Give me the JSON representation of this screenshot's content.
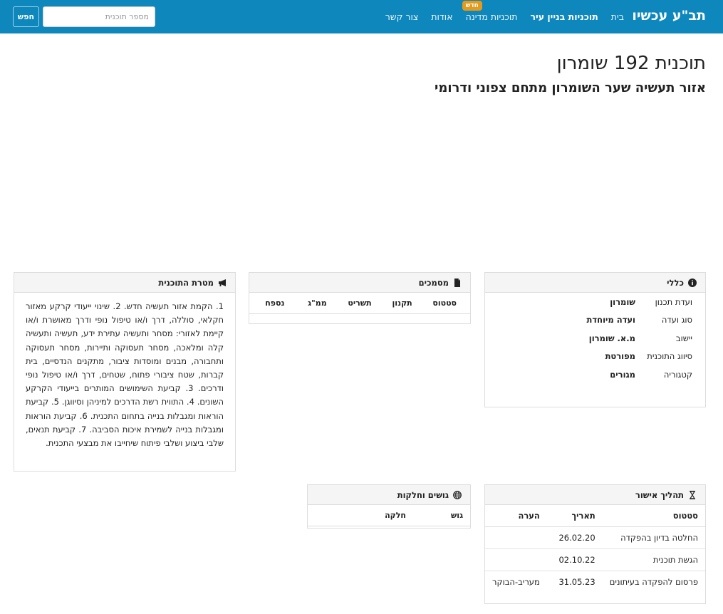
{
  "navbar": {
    "brand": "תב\"ע עכשיו",
    "links": [
      {
        "label": "בית"
      },
      {
        "label": "תוכניות בניין עיר"
      },
      {
        "label": "תוכניות מדינה",
        "badge": "חדש"
      },
      {
        "label": "אודות"
      },
      {
        "label": "צור קשר"
      }
    ],
    "search_placeholder": "מספר תוכנית",
    "search_button": "חפש"
  },
  "page": {
    "title": "תוכנית 192 שומרון",
    "subtitle": "אזור תעשיה שער השומרון מתחם צפוני ודרומי"
  },
  "general": {
    "heading": "כללי",
    "rows": [
      {
        "key": "ועדת תכנון",
        "value": "שומרון"
      },
      {
        "key": "סוג ועדה",
        "value": "ועדה מיוחדת"
      },
      {
        "key": "יישוב",
        "value": "מ.א. שומרון"
      },
      {
        "key": "סיווג התוכנית",
        "value": "מפורטת"
      },
      {
        "key": "קטגוריה",
        "value": "מגורים"
      }
    ]
  },
  "documents": {
    "heading": "מסמכים",
    "columns": [
      "סטטוס",
      "תקנון",
      "תשריט",
      "ממ\"ג",
      "נספח"
    ]
  },
  "purpose": {
    "heading": "מטרת התוכנית",
    "text": "1. הקמת אזור תעשיה חדש. 2. שינוי ייעודי קרקע מאזור חקלאי, סוללה, דרך ו/או טיפול נופי ודרך מאושרת ו/או קיימת לאזורי: מסחר ותעשיה עתירת ידע, תעשיה ותעשיה קלה ומלאכה, מסחר תעסוקה ותיירות, מסחר תעסוקה ותחבורה, מבנים ומוסדות ציבור, מתקנים הנדסיים, בית קברות, שטח ציבורי פתוח, שטחים, דרך ו/או טיפול נופי ודרכים. 3. קביעת השימושים המותרים בייעודי הקרקע השונים. 4. התווית רשת הדרכים למיניהן וסיווגן. 5. קביעת הוראות ומגבלות בנייה בתחום התכנית. 6. קביעת הוראות ומגבלות בנייה לשמירת איכות הסביבה. 7. קביעת תנאים, שלבי ביצוע ושלבי פיתוח שיחייבו את מבצעי התכנית."
  },
  "approval": {
    "heading": "תהליך אישור",
    "columns": [
      "סטטוס",
      "תאריך",
      "הערה"
    ],
    "rows": [
      {
        "status": "החלטה בדיון בהפקדה",
        "date": "26.02.20",
        "note": ""
      },
      {
        "status": "הגשת תוכנית",
        "date": "02.10.22",
        "note": ""
      },
      {
        "status": "פרסום להפקדה בעיתונים",
        "date": "31.05.23",
        "note": "מעריב-הבוקר"
      }
    ]
  },
  "parcels": {
    "heading": "גושים וחלקות",
    "columns": [
      "גוש",
      "חלקה"
    ]
  },
  "colors": {
    "navbar": "#0e87bd",
    "badge": "#e59a1c"
  }
}
